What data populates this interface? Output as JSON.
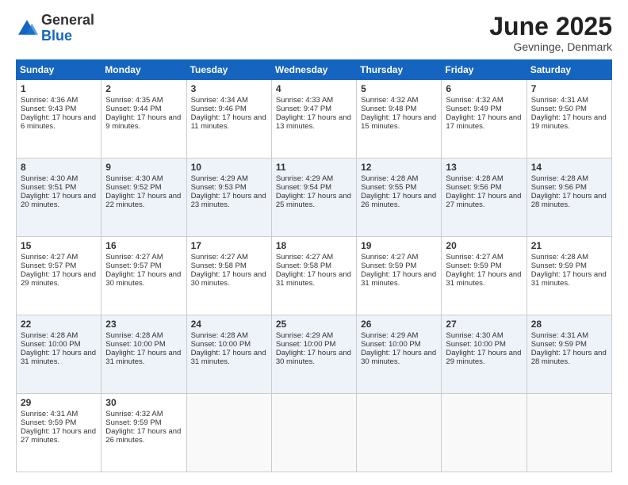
{
  "header": {
    "logo_general": "General",
    "logo_blue": "Blue",
    "month_title": "June 2025",
    "location": "Gevninge, Denmark"
  },
  "weekdays": [
    "Sunday",
    "Monday",
    "Tuesday",
    "Wednesday",
    "Thursday",
    "Friday",
    "Saturday"
  ],
  "weeks": [
    [
      {
        "day": 1,
        "sunrise": "4:36 AM",
        "sunset": "9:43 PM",
        "daylight": "17 hours and 6 minutes."
      },
      {
        "day": 2,
        "sunrise": "4:35 AM",
        "sunset": "9:44 PM",
        "daylight": "17 hours and 9 minutes."
      },
      {
        "day": 3,
        "sunrise": "4:34 AM",
        "sunset": "9:46 PM",
        "daylight": "17 hours and 11 minutes."
      },
      {
        "day": 4,
        "sunrise": "4:33 AM",
        "sunset": "9:47 PM",
        "daylight": "17 hours and 13 minutes."
      },
      {
        "day": 5,
        "sunrise": "4:32 AM",
        "sunset": "9:48 PM",
        "daylight": "17 hours and 15 minutes."
      },
      {
        "day": 6,
        "sunrise": "4:32 AM",
        "sunset": "9:49 PM",
        "daylight": "17 hours and 17 minutes."
      },
      {
        "day": 7,
        "sunrise": "4:31 AM",
        "sunset": "9:50 PM",
        "daylight": "17 hours and 19 minutes."
      }
    ],
    [
      {
        "day": 8,
        "sunrise": "4:30 AM",
        "sunset": "9:51 PM",
        "daylight": "17 hours and 20 minutes."
      },
      {
        "day": 9,
        "sunrise": "4:30 AM",
        "sunset": "9:52 PM",
        "daylight": "17 hours and 22 minutes."
      },
      {
        "day": 10,
        "sunrise": "4:29 AM",
        "sunset": "9:53 PM",
        "daylight": "17 hours and 23 minutes."
      },
      {
        "day": 11,
        "sunrise": "4:29 AM",
        "sunset": "9:54 PM",
        "daylight": "17 hours and 25 minutes."
      },
      {
        "day": 12,
        "sunrise": "4:28 AM",
        "sunset": "9:55 PM",
        "daylight": "17 hours and 26 minutes."
      },
      {
        "day": 13,
        "sunrise": "4:28 AM",
        "sunset": "9:56 PM",
        "daylight": "17 hours and 27 minutes."
      },
      {
        "day": 14,
        "sunrise": "4:28 AM",
        "sunset": "9:56 PM",
        "daylight": "17 hours and 28 minutes."
      }
    ],
    [
      {
        "day": 15,
        "sunrise": "4:27 AM",
        "sunset": "9:57 PM",
        "daylight": "17 hours and 29 minutes."
      },
      {
        "day": 16,
        "sunrise": "4:27 AM",
        "sunset": "9:57 PM",
        "daylight": "17 hours and 30 minutes."
      },
      {
        "day": 17,
        "sunrise": "4:27 AM",
        "sunset": "9:58 PM",
        "daylight": "17 hours and 30 minutes."
      },
      {
        "day": 18,
        "sunrise": "4:27 AM",
        "sunset": "9:58 PM",
        "daylight": "17 hours and 31 minutes."
      },
      {
        "day": 19,
        "sunrise": "4:27 AM",
        "sunset": "9:59 PM",
        "daylight": "17 hours and 31 minutes."
      },
      {
        "day": 20,
        "sunrise": "4:27 AM",
        "sunset": "9:59 PM",
        "daylight": "17 hours and 31 minutes."
      },
      {
        "day": 21,
        "sunrise": "4:28 AM",
        "sunset": "9:59 PM",
        "daylight": "17 hours and 31 minutes."
      }
    ],
    [
      {
        "day": 22,
        "sunrise": "4:28 AM",
        "sunset": "10:00 PM",
        "daylight": "17 hours and 31 minutes."
      },
      {
        "day": 23,
        "sunrise": "4:28 AM",
        "sunset": "10:00 PM",
        "daylight": "17 hours and 31 minutes."
      },
      {
        "day": 24,
        "sunrise": "4:28 AM",
        "sunset": "10:00 PM",
        "daylight": "17 hours and 31 minutes."
      },
      {
        "day": 25,
        "sunrise": "4:29 AM",
        "sunset": "10:00 PM",
        "daylight": "17 hours and 30 minutes."
      },
      {
        "day": 26,
        "sunrise": "4:29 AM",
        "sunset": "10:00 PM",
        "daylight": "17 hours and 30 minutes."
      },
      {
        "day": 27,
        "sunrise": "4:30 AM",
        "sunset": "10:00 PM",
        "daylight": "17 hours and 29 minutes."
      },
      {
        "day": 28,
        "sunrise": "4:31 AM",
        "sunset": "9:59 PM",
        "daylight": "17 hours and 28 minutes."
      }
    ],
    [
      {
        "day": 29,
        "sunrise": "4:31 AM",
        "sunset": "9:59 PM",
        "daylight": "17 hours and 27 minutes."
      },
      {
        "day": 30,
        "sunrise": "4:32 AM",
        "sunset": "9:59 PM",
        "daylight": "17 hours and 26 minutes."
      },
      null,
      null,
      null,
      null,
      null
    ]
  ]
}
